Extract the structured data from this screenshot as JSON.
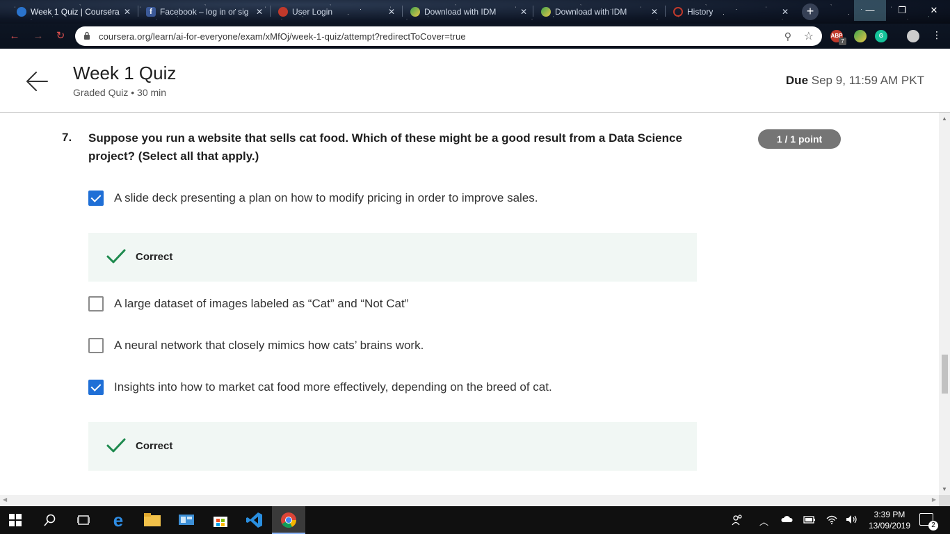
{
  "browser": {
    "tabs": [
      {
        "title": "Week 1 Quiz | Coursera",
        "icon": "coursera-icon",
        "active": true
      },
      {
        "title": "Facebook – log in or sig",
        "icon": "facebook-icon"
      },
      {
        "title": "User Login",
        "icon": "user-login-icon"
      },
      {
        "title": "Download with IDM",
        "icon": "idm-icon"
      },
      {
        "title": "Download with IDM",
        "icon": "idm-icon"
      },
      {
        "title": "History",
        "icon": "history-icon"
      }
    ],
    "url": "coursera.org/learn/ai-for-everyone/exam/xMfOj/week-1-quiz/attempt?redirectToCover=true",
    "extension_badge": "7",
    "extension_label": "ABP"
  },
  "header": {
    "title": "Week 1 Quiz",
    "meta": "Graded Quiz • 30 min",
    "due_label": "Due",
    "due_value": "Sep 9, 11:59 AM PKT"
  },
  "question": {
    "number": "7.",
    "text": "Suppose you run a website that sells cat food. Which of these might be a good result from a Data Science project? (Select all that apply.)",
    "points": "1 / 1 point",
    "options": [
      {
        "text": "A slide deck presenting a plan on how to modify pricing in order to improve sales.",
        "checked": true,
        "feedback": "Correct"
      },
      {
        "text": "A large dataset of images labeled as “Cat” and “Not Cat”",
        "checked": false
      },
      {
        "text": "A neural network that closely mimics how cats’ brains work.",
        "checked": false
      },
      {
        "text": "Insights into how to market cat food more effectively, depending on the breed of cat.",
        "checked": true,
        "feedback": "Correct"
      }
    ]
  },
  "taskbar": {
    "time": "3:39 PM",
    "date": "13/09/2019",
    "notifications": "2"
  },
  "colors": {
    "accent_blue": "#1f6fd6",
    "correct_green": "#1e8a4e",
    "feedback_bg": "#f1f7f4",
    "points_badge": "#757575"
  }
}
